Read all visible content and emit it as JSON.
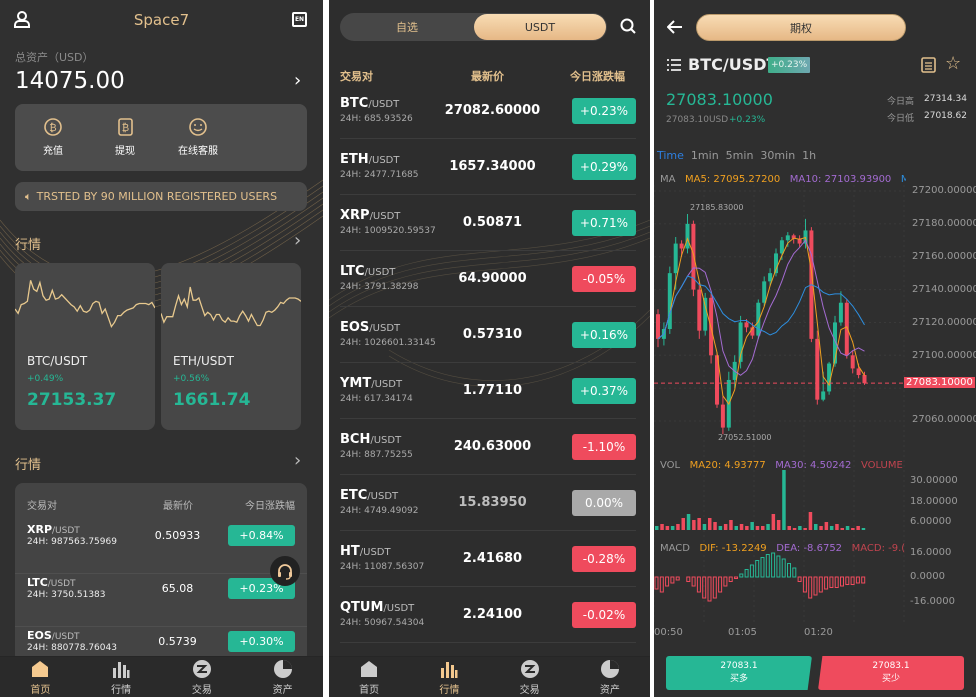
{
  "colors": {
    "up": "#26b795",
    "down": "#ef4b5d",
    "gold": "#e2c08d",
    "flat": "#a9a9a9"
  },
  "home": {
    "title": "Space7",
    "lang_icon": "EN",
    "total_label": "总资产（USD）",
    "total_value": "14075.00",
    "actions": [
      {
        "label": "充值",
        "icon": "bitcoin-deposit-icon"
      },
      {
        "label": "提现",
        "icon": "bitcoin-withdraw-icon"
      },
      {
        "label": "在线客服",
        "icon": "smile-chat-icon"
      }
    ],
    "banner": "TRSTED BY 90 MILLION REGISTERED USERS",
    "section1": "行情",
    "section2": "行情",
    "cards": [
      {
        "pair": "BTC/USDT",
        "change": "+0.49%",
        "price": "27153.37",
        "spark": [
          40,
          36,
          44,
          45,
          47,
          66,
          58,
          56,
          64,
          52,
          48,
          49,
          57,
          49,
          50,
          53,
          50,
          47,
          44,
          42,
          38,
          43,
          38,
          37,
          39,
          45,
          47,
          46,
          36,
          40,
          32,
          24,
          28,
          34,
          34,
          37,
          39,
          40,
          41,
          44,
          45,
          45,
          45,
          44,
          46,
          41
        ]
      },
      {
        "pair": "ETH/USDT",
        "change": "+0.56%",
        "price": "1661.74",
        "spark": [
          36,
          28,
          33,
          33,
          33,
          43,
          52,
          44,
          49,
          42,
          60,
          48,
          48,
          50,
          42,
          34,
          37,
          35,
          30,
          35,
          35,
          30,
          28,
          32,
          29,
          29,
          28,
          34,
          38,
          34,
          29,
          35,
          30,
          25,
          25,
          30,
          37,
          38,
          37,
          39,
          42,
          46,
          45,
          48,
          50,
          50,
          50,
          49,
          47
        ]
      }
    ],
    "table": {
      "headers": [
        "交易对",
        "最新价",
        "今日涨跌幅"
      ],
      "rows": [
        {
          "base": "XRP",
          "quote": "/USDT",
          "vol": "24H: 987563.75969",
          "price": "0.50933",
          "change": "+0.84%",
          "dir": "up"
        },
        {
          "base": "LTC",
          "quote": "/USDT",
          "vol": "24H: 3750.51383",
          "price": "65.08",
          "change": "+0.23%",
          "dir": "up"
        },
        {
          "base": "EOS",
          "quote": "/USDT",
          "vol": "24H: 880778.76043",
          "price": "0.5739",
          "change": "+0.30%",
          "dir": "up"
        }
      ]
    }
  },
  "nav": [
    "首页",
    "行情",
    "交易",
    "资产"
  ],
  "market": {
    "tabs": [
      "自选",
      "USDT"
    ],
    "active_tab": "USDT",
    "headers": [
      "交易对",
      "最新价",
      "今日涨跌幅"
    ],
    "rows": [
      {
        "base": "BTC",
        "quote": "/USDT",
        "vol": "24H: 685.93526",
        "price": "27082.60000",
        "change": "+0.23%",
        "dir": "up"
      },
      {
        "base": "ETH",
        "quote": "/USDT",
        "vol": "24H: 2477.71685",
        "price": "1657.34000",
        "change": "+0.29%",
        "dir": "up"
      },
      {
        "base": "XRP",
        "quote": "/USDT",
        "vol": "24H: 1009520.59537",
        "price": "0.50871",
        "change": "+0.71%",
        "dir": "up"
      },
      {
        "base": "LTC",
        "quote": "/USDT",
        "vol": "24H: 3791.38298",
        "price": "64.90000",
        "change": "-0.05%",
        "dir": "down"
      },
      {
        "base": "EOS",
        "quote": "/USDT",
        "vol": "24H: 1026601.33145",
        "price": "0.57310",
        "change": "+0.16%",
        "dir": "up"
      },
      {
        "base": "YMT",
        "quote": "/USDT",
        "vol": "24H: 617.34174",
        "price": "1.77110",
        "change": "+0.37%",
        "dir": "up"
      },
      {
        "base": "BCH",
        "quote": "/USDT",
        "vol": "24H: 887.75255",
        "price": "240.63000",
        "change": "-1.10%",
        "dir": "down"
      },
      {
        "base": "ETC",
        "quote": "/USDT",
        "vol": "24H: 4749.49092",
        "price": "15.83950",
        "change": "0.00%",
        "dir": "flat"
      },
      {
        "base": "HT",
        "quote": "/USDT",
        "vol": "24H: 11087.56307",
        "price": "2.41680",
        "change": "-0.28%",
        "dir": "down"
      },
      {
        "base": "QTUM",
        "quote": "/USDT",
        "vol": "24H: 50967.54304",
        "price": "2.24100",
        "change": "-0.02%",
        "dir": "down"
      }
    ]
  },
  "trade": {
    "pill": "期权",
    "pair": "BTC/USDT",
    "pair_change": "+0.23%",
    "price": "27083.10000",
    "price_usd": "27083.10USD",
    "price_change": "+0.23%",
    "high_label": "今日高",
    "high": "27314.34",
    "low_label": "今日低",
    "low": "27018.62",
    "intervals": [
      "Time",
      "1min",
      "5min",
      "30min",
      "1h"
    ],
    "active_interval": "Time",
    "ma_label": "MA",
    "ma5": "MA5: 27095.27200",
    "ma10": "MA10: 27103.93900",
    "ma30": "M",
    "price_axis": [
      "27200.00000",
      "27180.00000",
      "27160.00000",
      "27140.00000",
      "27120.00000",
      "27100.00000",
      "27083.10000",
      "27060.00000"
    ],
    "current_price_tag": "27083.10000",
    "max_label": "27185.83000",
    "min_label": "27052.51000",
    "vol_label": "VOL",
    "vol_ma20": "MA20: 4.93777",
    "vol_ma30": "MA30: 4.50242",
    "vol_volume": "VOLUME",
    "vol_axis": [
      "30.00000",
      "18.00000",
      "6.00000"
    ],
    "macd_label": "MACD",
    "dif": "DIF: -13.2249",
    "dea": "DEA: -8.6752",
    "macd": "MACD: -9.(",
    "macd_axis": [
      "16.0000",
      "0.0000",
      "-16.0000"
    ],
    "time_axis": [
      "00:50",
      "01:05",
      "01:20"
    ],
    "buy": {
      "price": "27083.1",
      "label": "买多"
    },
    "sell": {
      "price": "27083.1",
      "label": "买少"
    },
    "candles": [
      [
        27125,
        27110,
        27128,
        27105
      ],
      [
        27110,
        27116,
        27120,
        27106
      ],
      [
        27116,
        27150,
        27154,
        27113
      ],
      [
        27150,
        27168,
        27172,
        27140
      ],
      [
        27168,
        27165,
        27170,
        27160
      ],
      [
        27165,
        27180,
        27186,
        27162
      ],
      [
        27180,
        27140,
        27182,
        27136
      ],
      [
        27140,
        27115,
        27145,
        27110
      ],
      [
        27115,
        27135,
        27138,
        27112
      ],
      [
        27135,
        27100,
        27138,
        27095
      ],
      [
        27100,
        27070,
        27102,
        27068
      ],
      [
        27070,
        27056,
        27075,
        27052
      ],
      [
        27056,
        27085,
        27090,
        27054
      ],
      [
        27085,
        27096,
        27100,
        27080
      ],
      [
        27096,
        27120,
        27124,
        27092
      ],
      [
        27120,
        27117,
        27122,
        27114
      ],
      [
        27117,
        27112,
        27120,
        27110
      ],
      [
        27112,
        27132,
        27134,
        27110
      ],
      [
        27132,
        27145,
        27148,
        27130
      ],
      [
        27145,
        27150,
        27153,
        27142
      ],
      [
        27150,
        27162,
        27165,
        27148
      ],
      [
        27162,
        27170,
        27172,
        27158
      ],
      [
        27170,
        27173,
        27175,
        27166
      ],
      [
        27173,
        27171,
        27174,
        27168
      ],
      [
        27171,
        27168,
        27173,
        27166
      ],
      [
        27168,
        27176,
        27183,
        27165
      ],
      [
        27176,
        27110,
        27178,
        27108
      ],
      [
        27110,
        27073,
        27115,
        27070
      ],
      [
        27073,
        27078,
        27090,
        27072
      ],
      [
        27078,
        27095,
        27096,
        27076
      ],
      [
        27095,
        27120,
        27124,
        27093
      ],
      [
        27120,
        27132,
        27139,
        27118
      ],
      [
        27132,
        27100,
        27134,
        27098
      ],
      [
        27100,
        27092,
        27103,
        27089
      ],
      [
        27092,
        27088,
        27095,
        27086
      ],
      [
        27088,
        27083,
        27090,
        27082
      ]
    ],
    "volumes": [
      2,
      3,
      2,
      2,
      3,
      6,
      8,
      5,
      6,
      3,
      6,
      4,
      2,
      3,
      5,
      2,
      3,
      2,
      4,
      2,
      2,
      3,
      8,
      5,
      30,
      2,
      1,
      2,
      1,
      9,
      3,
      2,
      4,
      2,
      3,
      1,
      2,
      1,
      2,
      1
    ],
    "macd_bars": [
      -8,
      -10,
      -6,
      -4,
      -2,
      0,
      -3,
      -6,
      -10,
      -14,
      -16,
      -14,
      -10,
      -6,
      -3,
      -1,
      2,
      5,
      8,
      11,
      13,
      15,
      16,
      14,
      12,
      9,
      6,
      -3,
      -10,
      -14,
      -12,
      -10,
      -8,
      -7,
      -7,
      -6,
      -5,
      -5,
      -4,
      -4
    ]
  }
}
